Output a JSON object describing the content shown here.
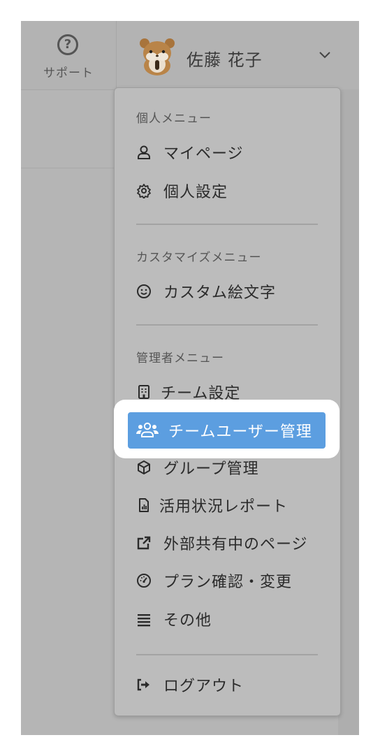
{
  "header": {
    "support_label": "サポート",
    "support_icon": "question-circle-icon",
    "user_name": "佐藤 花子",
    "avatar": "hamster-avatar",
    "dropdown_icon": "chevron-down-icon"
  },
  "menu": {
    "personal": {
      "title": "個人メニュー",
      "items": [
        {
          "label": "マイページ",
          "icon": "user-icon"
        },
        {
          "label": "個人設定",
          "icon": "gear-icon"
        }
      ]
    },
    "customize": {
      "title": "カスタマイズメニュー",
      "items": [
        {
          "label": "カスタム絵文字",
          "icon": "smile-icon"
        }
      ]
    },
    "admin": {
      "title": "管理者メニュー",
      "items": [
        {
          "label": "チーム設定",
          "icon": "building-icon"
        },
        {
          "label": "チームユーザー管理",
          "icon": "users-icon",
          "highlighted": true
        },
        {
          "label": "グループ管理",
          "icon": "cube-icon"
        },
        {
          "label": "活用状況レポート",
          "icon": "report-icon"
        },
        {
          "label": "外部共有中のページ",
          "icon": "external-link-icon"
        },
        {
          "label": "プラン確認・変更",
          "icon": "gauge-icon"
        },
        {
          "label": "その他",
          "icon": "menu-lines-icon"
        }
      ]
    },
    "logout": {
      "label": "ログアウト",
      "icon": "logout-icon"
    }
  },
  "colors": {
    "overlay": "#b5b5b5",
    "highlight": "#5c9ee0",
    "highlight_text": "#ffffff"
  }
}
